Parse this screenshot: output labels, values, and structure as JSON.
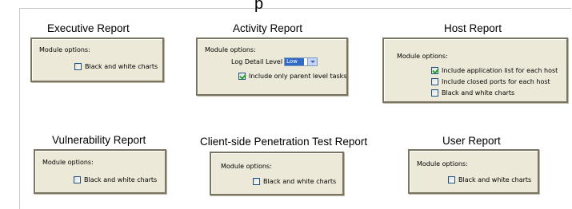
{
  "heading_fragment": "p",
  "reports": [
    {
      "title": "Executive Report",
      "module_options_label": "Module options:",
      "options": [
        {
          "label": "Black and white charts",
          "checked": false
        }
      ]
    },
    {
      "title": "Activity Report",
      "module_options_label": "Module options:",
      "log_detail": {
        "label": "Log Detail Level",
        "value": "Low"
      },
      "options": [
        {
          "label": "Include only parent level tasks",
          "checked": true
        }
      ]
    },
    {
      "title": "Host Report",
      "module_options_label": "Module options:",
      "options": [
        {
          "label": "Include application list for each host",
          "checked": true
        },
        {
          "label": "Include closed ports for each host",
          "checked": false
        },
        {
          "label": "Black and white charts",
          "checked": false
        }
      ]
    },
    {
      "title": "Vulnerability Report",
      "module_options_label": "Module options:",
      "options": [
        {
          "label": "Black and white charts",
          "checked": false
        }
      ]
    },
    {
      "title": "Client-side Penetration Test Report",
      "module_options_label": "Module options:",
      "options": [
        {
          "label": "Black and white charts",
          "checked": false
        }
      ]
    },
    {
      "title": "User Report",
      "module_options_label": "Module options:",
      "options": [
        {
          "label": "Black and white charts",
          "checked": false
        }
      ]
    }
  ]
}
